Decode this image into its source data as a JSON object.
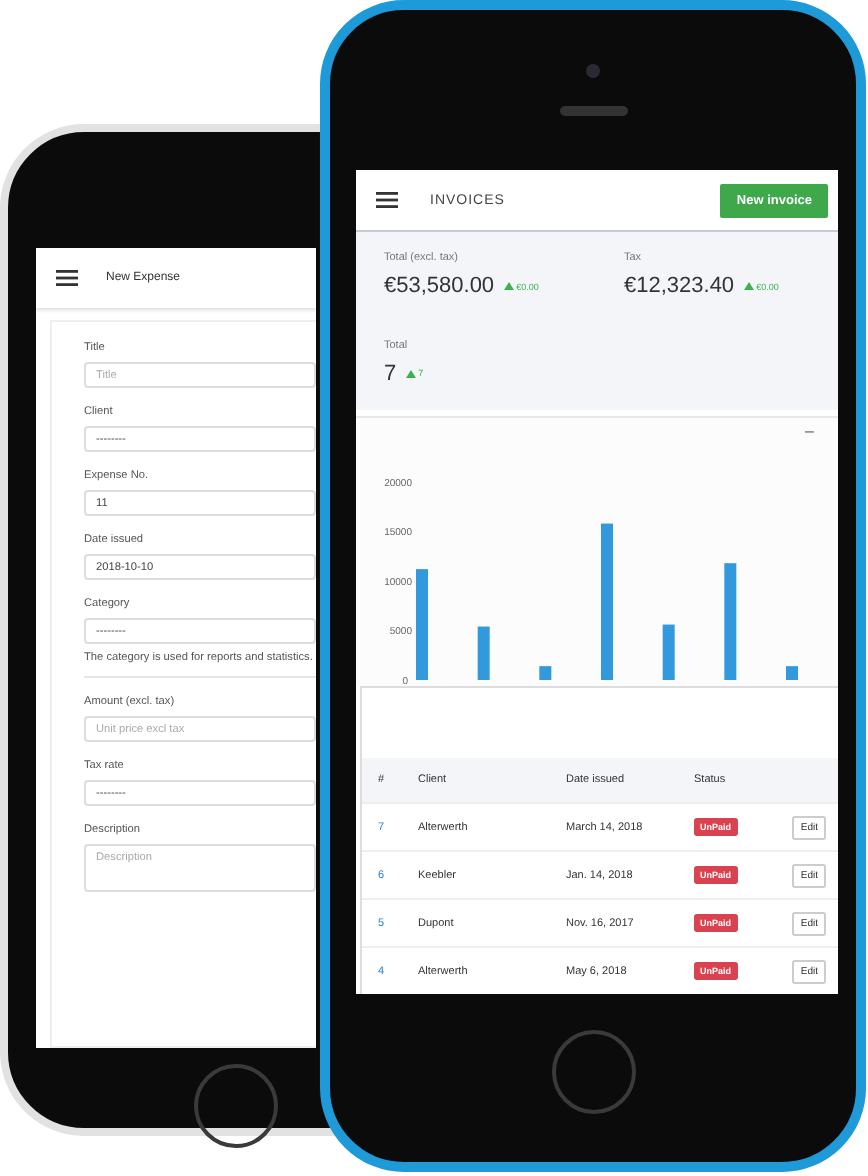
{
  "expense_screen": {
    "title": "New Expense",
    "fields": [
      {
        "label": "Title",
        "kind": "input",
        "placeholder": "Title"
      },
      {
        "label": "Client",
        "kind": "select",
        "value": "--------"
      },
      {
        "label": "Expense No.",
        "kind": "input",
        "value": "11"
      },
      {
        "label": "Date issued",
        "kind": "input",
        "value": "2018-10-10"
      },
      {
        "label": "Category",
        "kind": "select",
        "value": "--------",
        "help": "The category is used for reports and statistics."
      },
      {
        "label": "Amount (excl. tax)",
        "kind": "input",
        "placeholder": "Unit price excl tax"
      },
      {
        "label": "Tax rate",
        "kind": "select",
        "value": "--------"
      },
      {
        "label": "Description",
        "kind": "textarea",
        "placeholder": "Description"
      }
    ]
  },
  "invoice_screen": {
    "title": "INVOICES",
    "new_button": "New invoice",
    "stats": [
      {
        "label": "Total (excl. tax)",
        "value": "€53,580.00",
        "change": "€0.00"
      },
      {
        "label": "Tax",
        "value": "€12,323.40",
        "change": "€0.00"
      },
      {
        "label": "Total",
        "value": "7",
        "change": "7"
      }
    ],
    "chart_toggle": "–",
    "chart_data": {
      "type": "bar",
      "categories": [
        null,
        null,
        null,
        null,
        null,
        null,
        null
      ],
      "ylim": [
        0,
        20000
      ],
      "yticks": [
        0,
        5000,
        10000,
        15000,
        20000
      ],
      "series": [
        {
          "color": "#3399dd",
          "values": [
            11200,
            5400,
            1400,
            15800,
            5600,
            11800,
            1400
          ]
        }
      ]
    },
    "table": {
      "columns": [
        "#",
        "Client",
        "Date issued",
        "Status"
      ],
      "rows": [
        {
          "number": "7",
          "client": "Alterwerth",
          "date": "March 14, 2018",
          "status": "UnPaid",
          "action": "Edit"
        },
        {
          "number": "6",
          "client": "Keebler",
          "date": "Jan. 14, 2018",
          "status": "UnPaid",
          "action": "Edit"
        },
        {
          "number": "5",
          "client": "Dupont",
          "date": "Nov. 16, 2017",
          "status": "UnPaid",
          "action": "Edit"
        },
        {
          "number": "4",
          "client": "Alterwerth",
          "date": "May 6, 2018",
          "status": "UnPaid",
          "action": "Edit"
        }
      ]
    }
  }
}
